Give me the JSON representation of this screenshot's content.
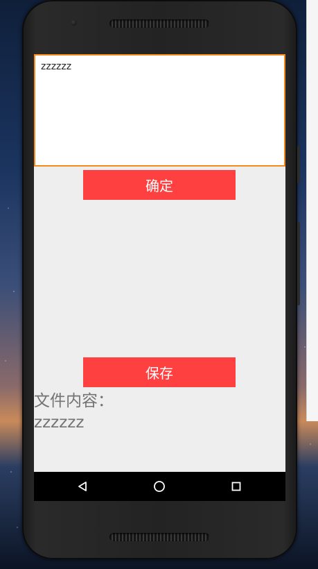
{
  "editor": {
    "value": "zzzzzz",
    "placeholder": ""
  },
  "buttons": {
    "confirm": "确定",
    "save": "保存"
  },
  "file": {
    "label": "文件内容：",
    "content": "zzzzzz"
  },
  "colors": {
    "accent": "#ff4040",
    "input_border": "#f48a1e",
    "screen_bg": "#eeeeee"
  },
  "navigation": {
    "back_icon": "back-triangle-icon",
    "home_icon": "home-circle-icon",
    "recents_icon": "recents-square-icon"
  }
}
